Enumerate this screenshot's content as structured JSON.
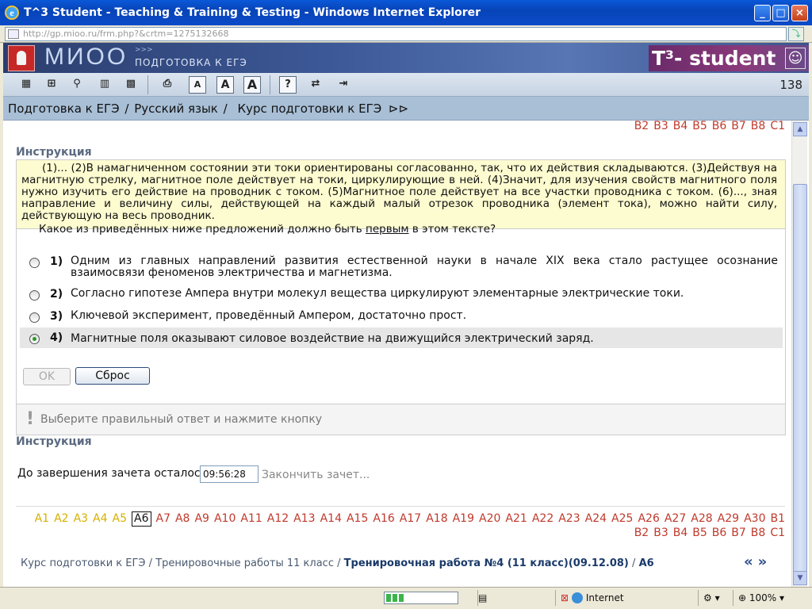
{
  "window": {
    "title": "T^3 Student - Teaching & Training & Testing - Windows Internet Explorer",
    "url": "http://gp.mioo.ru/frm.php?&crtm=1275132668"
  },
  "banner": {
    "logo": "МИОО",
    "subtitle": "ПОДГОТОВКА К ЕГЭ",
    "arrows": ">>>",
    "brand": "T³- student"
  },
  "toolbar": {
    "page_number": "138",
    "font_small": "A",
    "font_medium": "A",
    "font_large": "A",
    "help": "?"
  },
  "breadcrumb": {
    "items": [
      "Подготовка к ЕГЭ",
      "Русский язык",
      "Курс подготовки к ЕГЭ"
    ],
    "sep": "/"
  },
  "top_links": [
    "B2",
    "B3",
    "B4",
    "B5",
    "B6",
    "B7",
    "B8",
    "C1"
  ],
  "instruction_title": "Инструкция",
  "instruction_text": "(1)... (2)В намагниченном состоянии эти токи ориентированы согласованно, так, что их действия складываются. (3)Действуя на магнитную стрелку, магнитное поле действует на токи, циркулирующие в ней. (4)Значит, для изучения свойств магнитного поля нужно изучить его действие на проводник с током. (5)Магнитное поле действует на все участки проводника с током. (6)..., зная направление и величину силы, действующей на каждый малый отрезок проводника (элемент тока), можно найти силу, действующую на весь проводник.",
  "question": {
    "before": "Какое из приведённых ниже предложений должно быть ",
    "emph": "первым",
    "after": " в этом тексте?"
  },
  "answers": [
    {
      "num": "1)",
      "text": "Одним из главных направлений развития естественной науки в начале XIX века стало растущее осознание взаимосвязи феноменов электричества и магнетизма.",
      "selected": false
    },
    {
      "num": "2)",
      "text": "Согласно гипотезе Ампера внутри молекул вещества циркулируют элементарные электрические токи.",
      "selected": false
    },
    {
      "num": "3)",
      "text": "Ключевой эксперимент, проведённый Ампером, достаточно прост.",
      "selected": false
    },
    {
      "num": "4)",
      "text": "Магнитные поля оказывают силовое воздействие на движущийся электрический заряд.",
      "selected": true
    }
  ],
  "buttons": {
    "ok": "OK",
    "reset": "Сброс"
  },
  "hint": "Выберите правильный ответ и нажмите кнопку",
  "instruction_title2": "Инструкция",
  "timer": {
    "label": "До завершения зачета осталось:",
    "value": "09:56:28",
    "finish": "Закончить зачет..."
  },
  "nav": {
    "done": [
      "A1",
      "A2",
      "A3",
      "A4",
      "A5"
    ],
    "current": "A6",
    "rest_line1": [
      "A7",
      "A8",
      "A9",
      "A10",
      "A11",
      "A12",
      "A13",
      "A14",
      "A15",
      "A16",
      "A17",
      "A18",
      "A19",
      "A20",
      "A21",
      "A22",
      "A23",
      "A24",
      "A25",
      "A26",
      "A27",
      "A28",
      "A29",
      "A30",
      "B1"
    ],
    "rest_line2": [
      "B2",
      "B3",
      "B4",
      "B5",
      "B6",
      "B7",
      "B8",
      "C1"
    ]
  },
  "footer": {
    "path1": "Курс подготовки к ЕГЭ",
    "path2": "Тренировочные работы 11 класс",
    "path3": "Тренировочная работа №4 (11 класс)(09.12.08)",
    "path4": "A6",
    "sep": "/"
  },
  "pager": {
    "prev": "«",
    "next": "»"
  },
  "statusbar": {
    "zone": "Internet",
    "zoom": "100%"
  },
  "colors": {
    "done": "#d4b000",
    "pending": "#c0392b",
    "instruction_bg": "#fdfbd0"
  }
}
